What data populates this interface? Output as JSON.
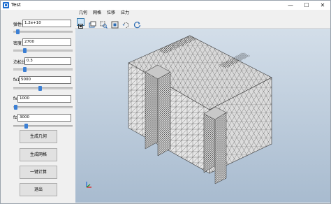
{
  "window": {
    "title": "Test",
    "min": "—",
    "max": "☐",
    "close": "✕"
  },
  "fields": [
    {
      "label": "弹性模量",
      "value": "1.2e+10"
    },
    {
      "label": "密度",
      "value": "2700"
    },
    {
      "label": "泊松比",
      "value": "0.3"
    },
    {
      "label": "fx1",
      "value": "5000"
    },
    {
      "label": "fx",
      "value": "1000"
    },
    {
      "label": "fz",
      "value": "3000"
    }
  ],
  "buttons": {
    "geometry": "生成几何",
    "mesh": "生成网格",
    "compute": "一键计算",
    "exit": "退出"
  },
  "menu": [
    "几何",
    "网格",
    "位移",
    "应力"
  ],
  "toolbar": {
    "icons": [
      "select-icon",
      "pan-icon",
      "zoom-window-icon",
      "zoom-fit-icon",
      "rotate-icon",
      "reset-view-icon"
    ],
    "active": "select-icon"
  },
  "viewport": {
    "background_top": "#d3dee9",
    "background_bottom": "#a8bbcf",
    "mesh_color": "#3a3a3a"
  }
}
